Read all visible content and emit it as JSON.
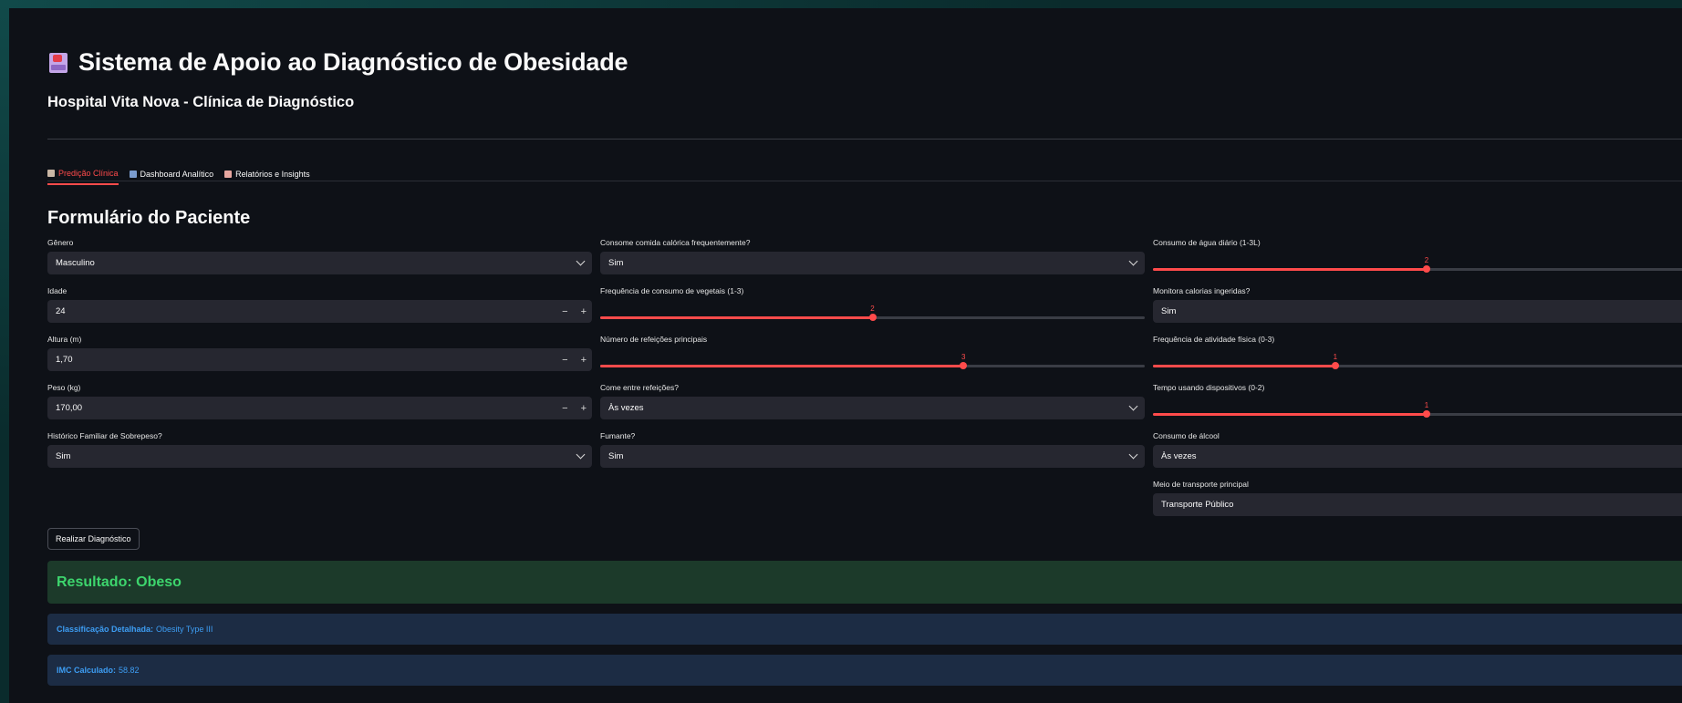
{
  "header": {
    "title": "Sistema de Apoio ao Diagnóstico de Obesidade",
    "title_icon": "hospital-icon",
    "subtitle": "Hospital Vita Nova - Clínica de Diagnóstico"
  },
  "tabs": [
    {
      "label": "Predição Clínica",
      "icon": "doctor-icon",
      "active": true
    },
    {
      "label": "Dashboard Analítico",
      "icon": "bar-chart-icon",
      "active": false
    },
    {
      "label": "Relatórios e Insights",
      "icon": "report-icon",
      "active": false
    }
  ],
  "form": {
    "title": "Formulário do Paciente",
    "col1": {
      "genero": {
        "label": "Gênero",
        "value": "Masculino"
      },
      "idade": {
        "label": "Idade",
        "value": "24"
      },
      "altura": {
        "label": "Altura (m)",
        "value": "1,70"
      },
      "peso": {
        "label": "Peso (kg)",
        "value": "170,00"
      },
      "historico": {
        "label": "Histórico Familiar de Sobrepeso?",
        "value": "Sim"
      }
    },
    "col2": {
      "calorica": {
        "label": "Consome comida calórica frequentemente?",
        "value": "Sim"
      },
      "vegetais": {
        "label": "Frequência de consumo de vegetais (1-3)",
        "value": "2",
        "min": 1,
        "max": 3,
        "fraction": 0.5
      },
      "refeicoes": {
        "label": "Número de refeições principais",
        "value": "3",
        "min": 1,
        "max": 4,
        "fraction": 0.667
      },
      "entre": {
        "label": "Come entre refeições?",
        "value": "Às vezes"
      },
      "fumante": {
        "label": "Fumante?",
        "value": "Sim"
      }
    },
    "col3": {
      "agua": {
        "label": "Consumo de água diário (1-3L)",
        "value": "2",
        "min": 1,
        "max": 3,
        "fraction": 0.5
      },
      "calorias": {
        "label": "Monitora calorias ingeridas?",
        "value": "Sim"
      },
      "atividade": {
        "label": "Frequência de atividade física (0-3)",
        "value": "1",
        "min": 0,
        "max": 3,
        "fraction": 0.333
      },
      "dispositivos": {
        "label": "Tempo usando dispositivos (0-2)",
        "value": "1",
        "min": 0,
        "max": 2,
        "fraction": 0.5
      },
      "alcool": {
        "label": "Consumo de álcool",
        "value": "Às vezes"
      },
      "transporte": {
        "label": "Meio de transporte principal",
        "value": "Transporte Público"
      }
    },
    "submit_label": "Realizar Diagnóstico"
  },
  "result": {
    "title": "Resultado: Obeso",
    "classificacao_label": "Classificação Detalhada:",
    "classificacao_value": "Obesity Type III",
    "imc_label": "IMC Calculado:",
    "imc_value": "58.82"
  },
  "colors": {
    "accent": "#ff4b4b",
    "success_text": "#3dd56d",
    "info_text": "#3d9df3",
    "app_bg": "#0e1117"
  }
}
